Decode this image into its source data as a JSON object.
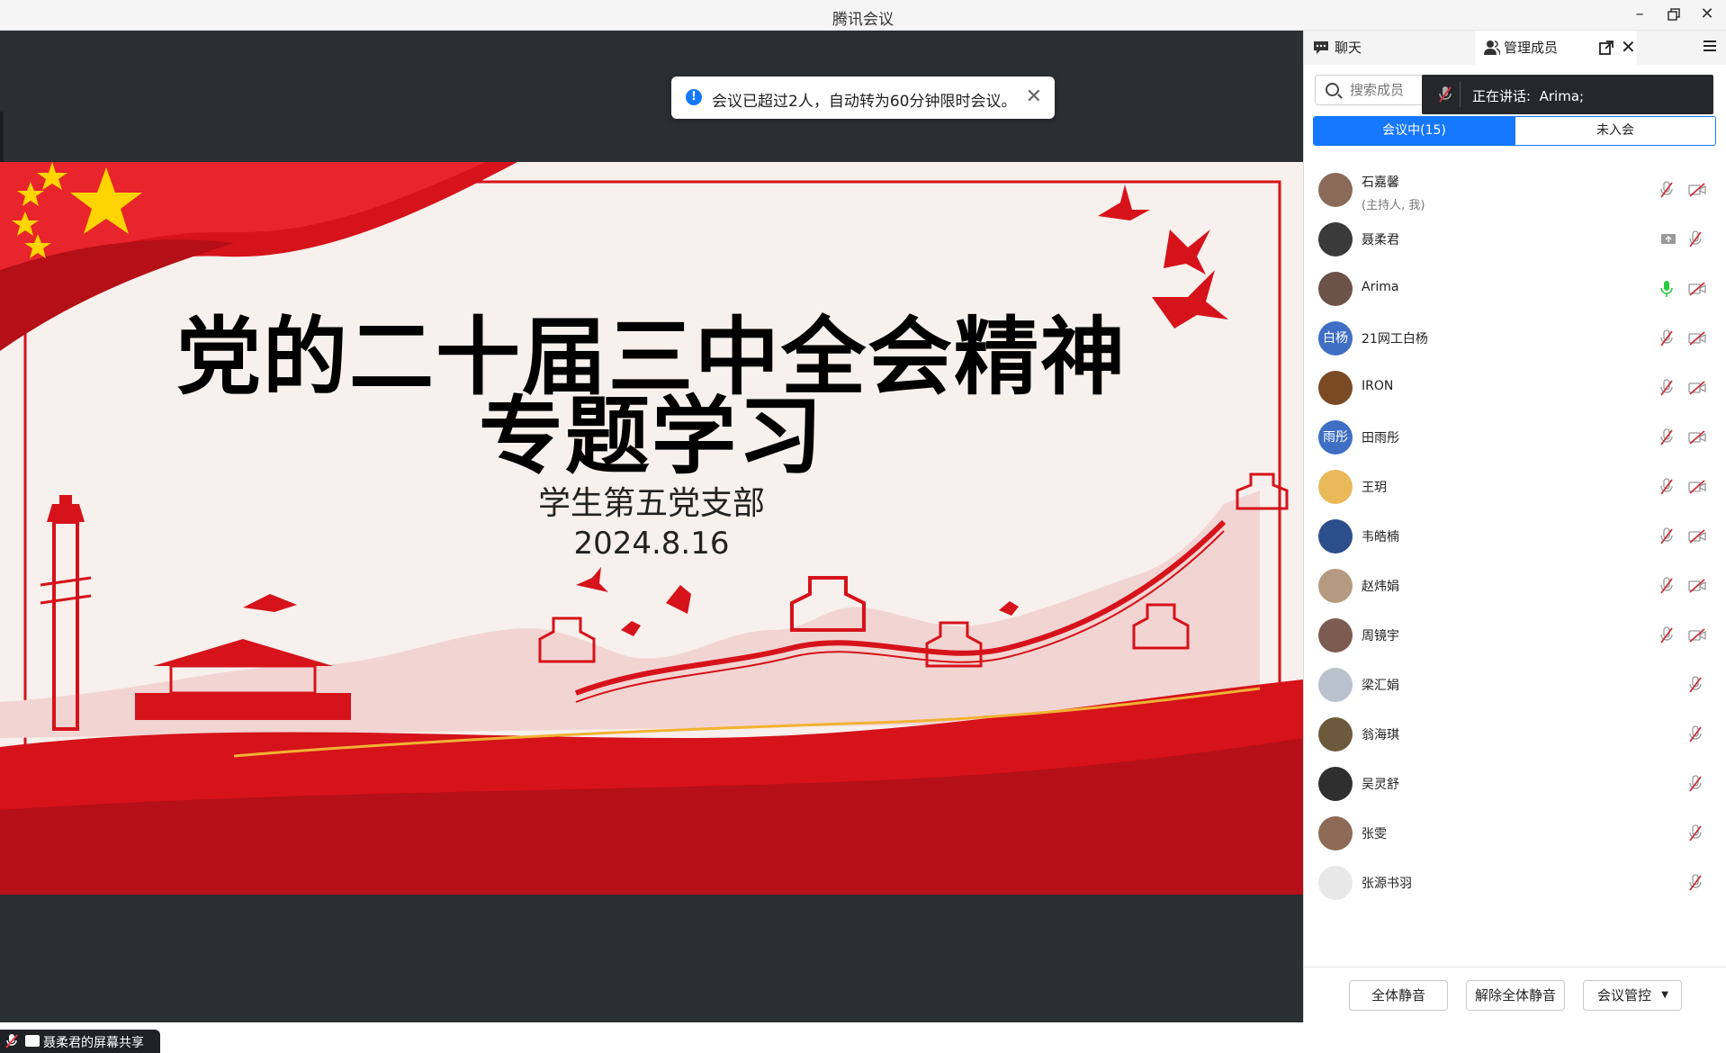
{
  "window": {
    "title": "腾讯会议"
  },
  "toast": {
    "message": "会议已超过2人，自动转为60分钟限时会议。"
  },
  "slide": {
    "title_line1": "党的二十届三中全会精神",
    "title_line2": "专题学习",
    "subtitle": "学生第五党支部",
    "date": "2024.8.16"
  },
  "share_tag": {
    "label": "聂柔君的屏幕共享"
  },
  "panel": {
    "tabs": {
      "chat": "聊天",
      "manage": "管理成员"
    },
    "search": {
      "placeholder": "搜索成员"
    },
    "speaking": {
      "label": "正在讲话:",
      "speaker": "Arima;"
    },
    "segments": {
      "in_meeting": "会议中(15)",
      "not_joined": "未入会"
    },
    "members": [
      {
        "name": "石嘉馨",
        "role": "(主持人, 我)",
        "avatar_text": "",
        "avatar_color": "#8a6a58",
        "mic": "muted",
        "cam": "off",
        "screen": false
      },
      {
        "name": "聂柔君",
        "role": "",
        "avatar_text": "",
        "avatar_color": "#3a3a3a",
        "mic": "muted",
        "cam": "none",
        "screen": true
      },
      {
        "name": "Arima",
        "role": "",
        "avatar_text": "",
        "avatar_color": "#6b5347",
        "mic": "on",
        "cam": "off",
        "screen": false
      },
      {
        "name": "21网工白杨",
        "role": "",
        "avatar_text": "白杨",
        "avatar_color": "#3f6fc4",
        "mic": "muted",
        "cam": "off",
        "screen": false
      },
      {
        "name": "IRON",
        "role": "",
        "avatar_text": "",
        "avatar_color": "#7a4a24",
        "mic": "muted",
        "cam": "off",
        "screen": false
      },
      {
        "name": "田雨彤",
        "role": "",
        "avatar_text": "雨彤",
        "avatar_color": "#3f6fc4",
        "mic": "muted",
        "cam": "off",
        "screen": false
      },
      {
        "name": "王玥",
        "role": "",
        "avatar_text": "",
        "avatar_color": "#e9b95a",
        "mic": "muted",
        "cam": "off",
        "screen": false
      },
      {
        "name": "韦皓楠",
        "role": "",
        "avatar_text": "",
        "avatar_color": "#2c4f8c",
        "mic": "muted",
        "cam": "off",
        "screen": false
      },
      {
        "name": "赵炜娟",
        "role": "",
        "avatar_text": "",
        "avatar_color": "#b59a80",
        "mic": "muted",
        "cam": "off",
        "screen": false
      },
      {
        "name": "周镜宇",
        "role": "",
        "avatar_text": "",
        "avatar_color": "#7c5b50",
        "mic": "muted",
        "cam": "off",
        "screen": false
      },
      {
        "name": "梁汇娟",
        "role": "",
        "avatar_text": "",
        "avatar_color": "#b9c1cc",
        "mic": "muted",
        "cam": "none",
        "screen": false
      },
      {
        "name": "翁海琪",
        "role": "",
        "avatar_text": "",
        "avatar_color": "#6d5a3c",
        "mic": "muted",
        "cam": "none",
        "screen": false
      },
      {
        "name": "吴灵舒",
        "role": "",
        "avatar_text": "",
        "avatar_color": "#2f2f2f",
        "mic": "muted",
        "cam": "none",
        "screen": false
      },
      {
        "name": "张雯",
        "role": "",
        "avatar_text": "",
        "avatar_color": "#8c6a55",
        "mic": "muted",
        "cam": "none",
        "screen": false
      },
      {
        "name": "张源书羽",
        "role": "",
        "avatar_text": "",
        "avatar_color": "#e8e8e8",
        "mic": "muted",
        "cam": "none",
        "screen": false
      }
    ],
    "buttons": {
      "mute_all": "全体静音",
      "unmute_all": "解除全体静音",
      "control": "会议管控"
    }
  },
  "colors": {
    "accent": "#1677ff",
    "mic_on": "#26c940",
    "muted": "#c9303a",
    "slide_red": "#d6121b"
  }
}
